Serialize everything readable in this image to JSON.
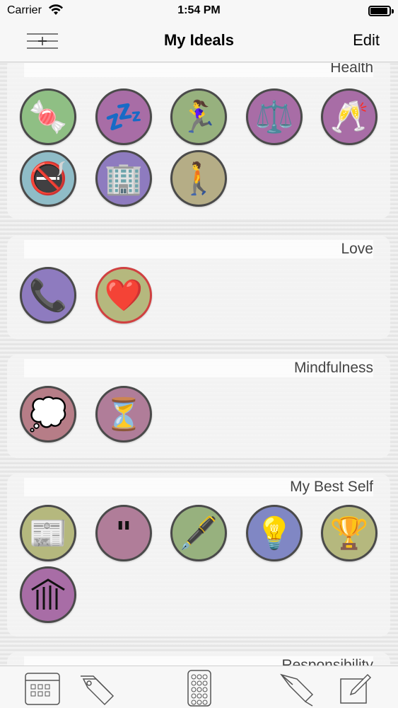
{
  "status_bar": {
    "carrier": "Carrier",
    "time": "1:54 PM"
  },
  "nav": {
    "title": "My Ideals",
    "edit_label": "Edit"
  },
  "sections": [
    {
      "name": "Health",
      "items": [
        {
          "icon": "candy-icon",
          "glyph": "🍬",
          "color": "#8fbf84"
        },
        {
          "icon": "sleep-icon",
          "glyph": "💤",
          "color": "#a86da6"
        },
        {
          "icon": "runner-icon",
          "glyph": "🏃‍♀️",
          "color": "#97b17e"
        },
        {
          "icon": "scales-icon",
          "glyph": "⚖️",
          "color": "#a86da6"
        },
        {
          "icon": "champagne-icon",
          "glyph": "🥂",
          "color": "#a86da6"
        },
        {
          "icon": "no-smoking-icon",
          "glyph": "🚭",
          "color": "#8fbcc7"
        },
        {
          "icon": "office-building-icon",
          "glyph": "🏢",
          "color": "#8e7bbf"
        },
        {
          "icon": "walking-icon",
          "glyph": "🚶",
          "color": "#b5ad86"
        }
      ]
    },
    {
      "name": "Love",
      "items": [
        {
          "icon": "telephone-icon",
          "glyph": "📞",
          "color": "#8e7bbf"
        },
        {
          "icon": "heart-icon",
          "glyph": "❤️",
          "color": "#b5b87e"
        }
      ]
    },
    {
      "name": "Mindfulness",
      "items": [
        {
          "icon": "thought-bubble-icon",
          "glyph": "💭",
          "color": "#b67d87"
        },
        {
          "icon": "hourglass-icon",
          "glyph": "⏳",
          "color": "#b07d99"
        }
      ]
    },
    {
      "name": "My Best Self",
      "items": [
        {
          "icon": "newspaper-icon",
          "glyph": "📰",
          "color": "#b5b87e"
        },
        {
          "icon": "quote-icon",
          "glyph": "\"",
          "color": "#b07d99"
        },
        {
          "icon": "fountain-pen-icon",
          "glyph": "🖋️",
          "color": "#97b17e"
        },
        {
          "icon": "light-bulb-icon",
          "glyph": "💡",
          "color": "#8087c4"
        },
        {
          "icon": "trophy-icon",
          "glyph": "🏆",
          "color": "#b5b87e"
        },
        {
          "icon": "classical-building-icon",
          "glyph": "🏛",
          "color": "#a86da6"
        }
      ]
    },
    {
      "name": "Responsibility",
      "items": []
    }
  ],
  "tabs": [
    {
      "icon": "calendar-icon"
    },
    {
      "icon": "tags-icon"
    },
    {
      "icon": "grid-dots-icon"
    },
    {
      "icon": "pen-nib-icon"
    },
    {
      "icon": "compose-icon"
    }
  ]
}
